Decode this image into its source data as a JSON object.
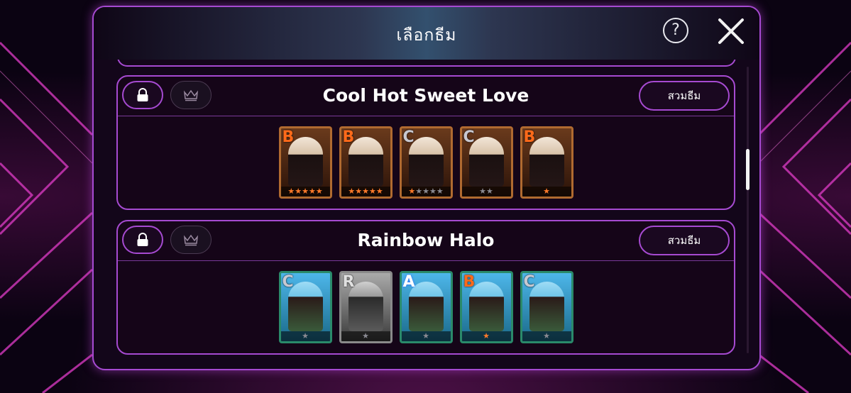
{
  "header": {
    "title": "เลือกธีม",
    "help_label": "?"
  },
  "themes": [
    {
      "title": "Cool Hot Sweet Love",
      "collect_label": "สวมธีม",
      "cards": [
        {
          "rank": "B",
          "stars_on": 5,
          "stars_total": 5,
          "style": "warm"
        },
        {
          "rank": "B",
          "stars_on": 5,
          "stars_total": 5,
          "style": "warm"
        },
        {
          "rank": "C",
          "stars_on": 1,
          "stars_total": 5,
          "style": "warm"
        },
        {
          "rank": "C",
          "stars_on": 0,
          "stars_total": 2,
          "style": "warm"
        },
        {
          "rank": "B",
          "stars_on": 1,
          "stars_total": 1,
          "style": "warm"
        }
      ]
    },
    {
      "title": "Rainbow Halo",
      "collect_label": "สวมธีม",
      "cards": [
        {
          "rank": "C",
          "stars_on": 0,
          "stars_total": 1,
          "style": "cool"
        },
        {
          "rank": "R",
          "stars_on": 0,
          "stars_total": 1,
          "style": "mono"
        },
        {
          "rank": "A",
          "stars_on": 0,
          "stars_total": 1,
          "style": "cool"
        },
        {
          "rank": "B",
          "stars_on": 1,
          "stars_total": 1,
          "style": "cool"
        },
        {
          "rank": "C",
          "stars_on": 0,
          "stars_total": 1,
          "style": "cool"
        }
      ]
    }
  ],
  "colors": {
    "accent": "#a64ad1",
    "star_on": "#ff7a2a",
    "star_off": "#8a8a92"
  }
}
